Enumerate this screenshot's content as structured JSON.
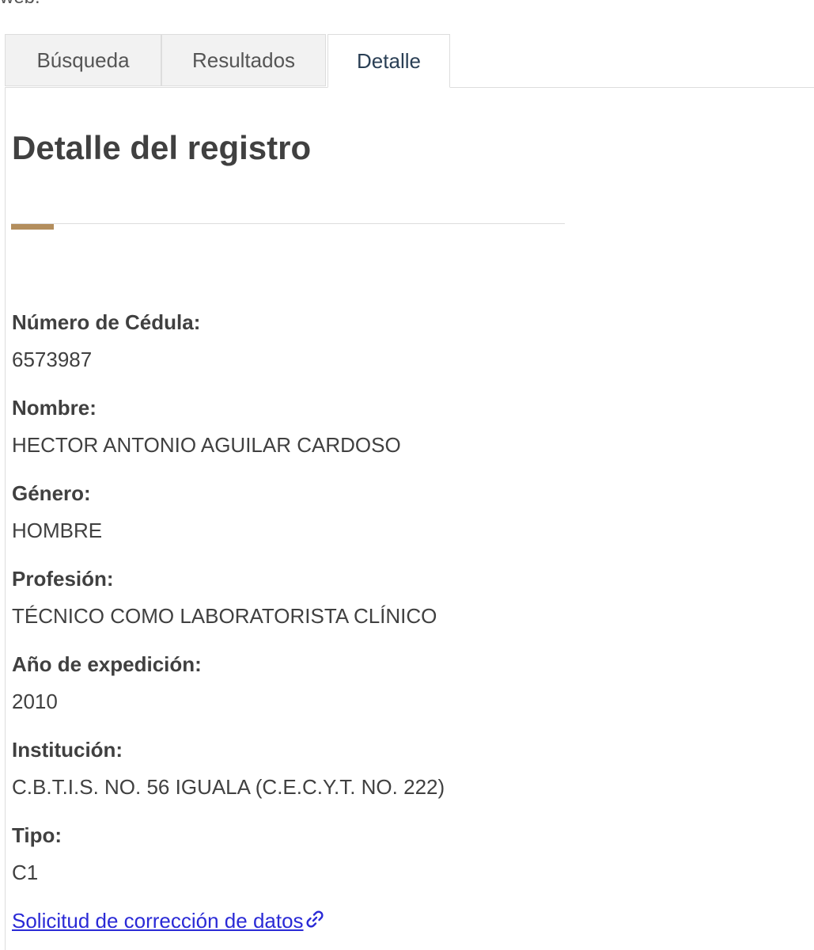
{
  "intro": {
    "text_fragment": "web."
  },
  "tabs": [
    {
      "label": "Búsqueda",
      "active": false
    },
    {
      "label": "Resultados",
      "active": false
    },
    {
      "label": "Detalle",
      "active": true
    }
  ],
  "detail": {
    "title": "Detalle del registro",
    "accent_color": "#b38e5d",
    "fields": [
      {
        "label": "Número de Cédula:",
        "value": "6573987"
      },
      {
        "label": "Nombre:",
        "value": "HECTOR ANTONIO AGUILAR CARDOSO"
      },
      {
        "label": "Género:",
        "value": "HOMBRE"
      },
      {
        "label": "Profesión:",
        "value": "TÉCNICO COMO LABORATORISTA CLÍNICO"
      },
      {
        "label": "Año de expedición:",
        "value": "2010"
      },
      {
        "label": "Institución:",
        "value": "C.B.T.I.S. NO. 56 IGUALA (C.E.C.Y.T. NO. 222)"
      },
      {
        "label": "Tipo:",
        "value": "C1"
      }
    ],
    "correction_link": {
      "label": "Solicitud de corrección de datos",
      "icon": "link-icon",
      "color": "#2a2ad6"
    }
  }
}
